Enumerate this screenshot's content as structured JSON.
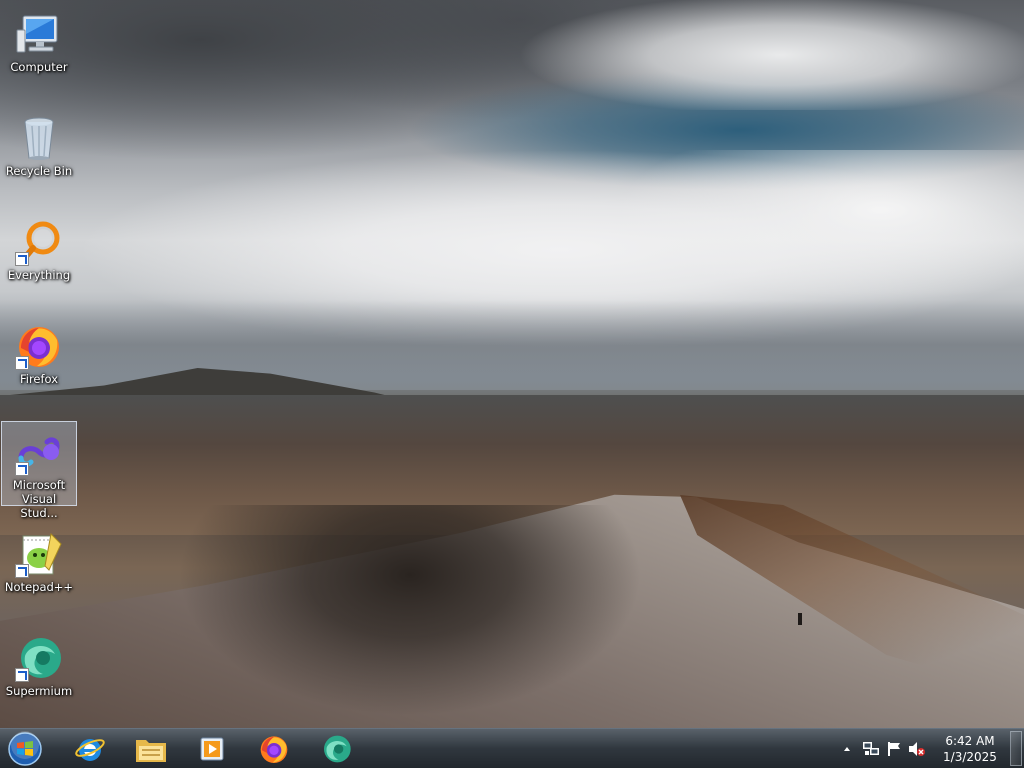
{
  "desktop": {
    "icons": [
      {
        "label": "Computer",
        "icon": "computer-icon",
        "shortcut": false
      },
      {
        "label": "Recycle Bin",
        "icon": "recycle-bin-icon",
        "shortcut": false
      },
      {
        "label": "Everything",
        "icon": "everything-search-icon",
        "shortcut": true
      },
      {
        "label": "Firefox",
        "icon": "firefox-icon",
        "shortcut": true
      },
      {
        "label": "Microsoft Visual Stud...",
        "icon": "visual-studio-icon",
        "shortcut": true,
        "selected": true
      },
      {
        "label": "Notepad++",
        "icon": "notepad-plus-plus-icon",
        "shortcut": true
      },
      {
        "label": "Supermium",
        "icon": "supermium-icon",
        "shortcut": true
      }
    ]
  },
  "taskbar": {
    "start_icon": "windows-start-orb-icon",
    "pinned": [
      {
        "name": "Internet Explorer",
        "icon": "internet-explorer-icon"
      },
      {
        "name": "Windows Explorer",
        "icon": "file-explorer-icon"
      },
      {
        "name": "Windows Media Player",
        "icon": "media-player-icon"
      },
      {
        "name": "Firefox",
        "icon": "firefox-icon"
      },
      {
        "name": "Supermium",
        "icon": "supermium-icon"
      }
    ],
    "tray": {
      "icons": [
        "show-hidden-icons-chevron",
        "network-icon",
        "action-center-flag-icon",
        "volume-muted-icon"
      ],
      "time": "6:42 AM",
      "date": "1/3/2025"
    }
  },
  "colors": {
    "taskbar_bg": "#1e262e",
    "label_text": "#ffffff",
    "shortcut_arrow": "#1d5ec9"
  }
}
